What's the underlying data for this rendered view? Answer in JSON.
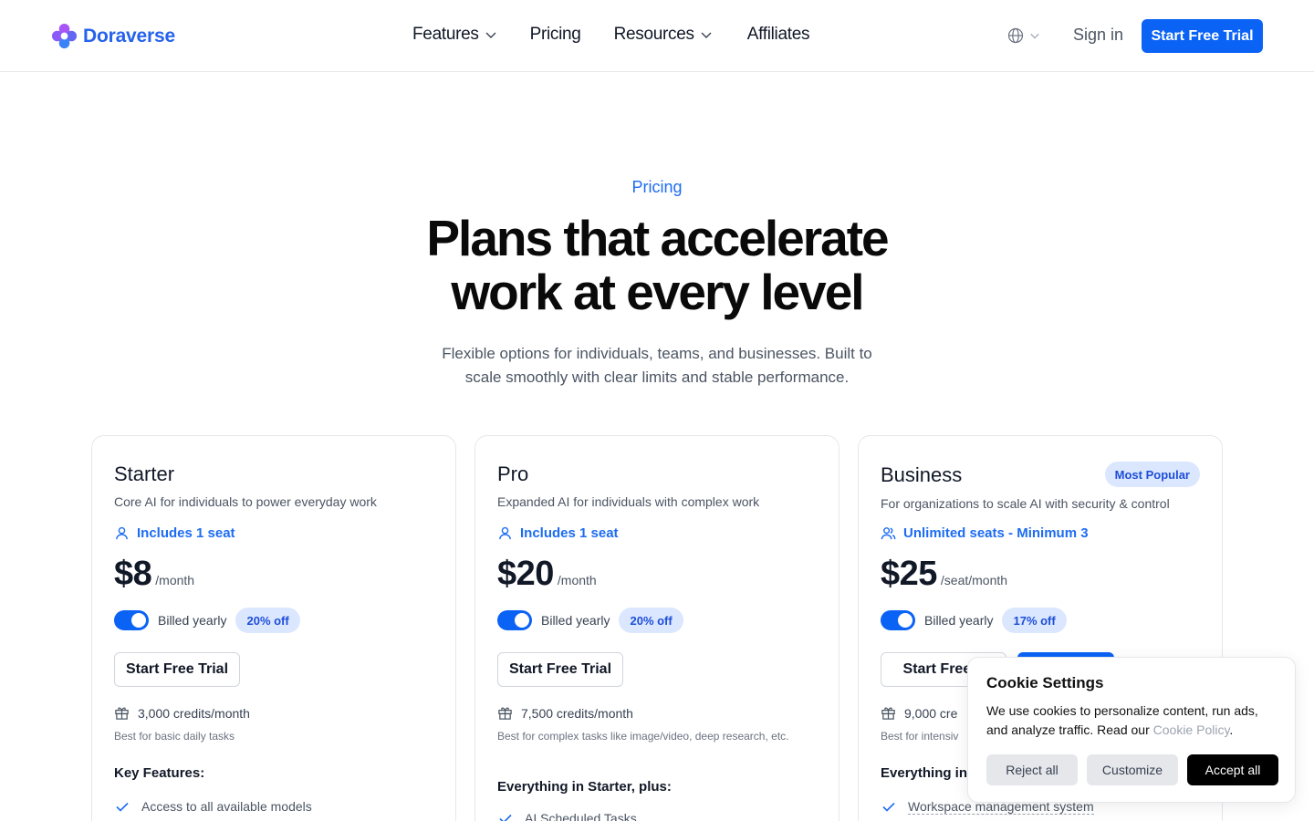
{
  "brand": {
    "name": "Doraverse"
  },
  "nav": {
    "items": [
      {
        "label": "Features",
        "has_dropdown": true
      },
      {
        "label": "Pricing",
        "has_dropdown": false
      },
      {
        "label": "Resources",
        "has_dropdown": true
      },
      {
        "label": "Affiliates",
        "has_dropdown": false
      }
    ],
    "language_icon": "globe-icon",
    "signin_label": "Sign in",
    "cta_label": "Start Free Trial"
  },
  "hero": {
    "eyebrow": "Pricing",
    "title_line1": "Plans that accelerate",
    "title_line2": "work at every level",
    "subtitle_line1": "Flexible options for individuals, teams, and businesses. Built to",
    "subtitle_line2": "scale smoothly with clear limits and stable performance."
  },
  "plans": [
    {
      "name": "Starter",
      "description": "Core AI for individuals to power everyday work",
      "seats": "Includes 1 seat",
      "price": "$8",
      "price_unit": "/month",
      "billing_label": "Billed yearly",
      "billed_yearly": true,
      "discount": "20% off",
      "cta_label": "Start Free Trial",
      "credits": "3,000 credits/month",
      "credits_note": "Best for basic daily tasks",
      "features_heading": "Key Features:",
      "features": [
        "Access to all available models"
      ]
    },
    {
      "name": "Pro",
      "description": "Expanded AI for individuals with complex work",
      "seats": "Includes 1 seat",
      "price": "$20",
      "price_unit": "/month",
      "billing_label": "Billed yearly",
      "billed_yearly": true,
      "discount": "20% off",
      "cta_label": "Start Free Trial",
      "credits": "7,500 credits/month",
      "credits_note": "Best for complex tasks like image/video, deep research, etc.",
      "features_heading": "Everything in Starter, plus:",
      "features": [
        "AI Scheduled Tasks"
      ]
    },
    {
      "name": "Business",
      "badge": "Most Popular",
      "description": "For organizations to scale AI with security & control",
      "seats": "Unlimited seats - Minimum 3",
      "price": "$25",
      "price_unit": "/seat/month",
      "billing_label": "Billed yearly",
      "billed_yearly": true,
      "discount": "17% off",
      "cta_label": "Start Free T",
      "credits": "9,000 cre",
      "credits_note": "Best for intensiv",
      "features_heading": "Everything in",
      "features": [
        "Workspace management system"
      ]
    }
  ],
  "cookie": {
    "title": "Cookie Settings",
    "text": "We use cookies to personalize content, run ads, and analyze traffic. Read our ",
    "link_label": "Cookie Policy",
    "text_end": ".",
    "reject_label": "Reject all",
    "customize_label": "Customize",
    "accept_label": "Accept all"
  },
  "colors": {
    "accent": "#0b63f6",
    "accent_text": "#1d6cf2",
    "badge_bg": "#dbe7ff"
  }
}
